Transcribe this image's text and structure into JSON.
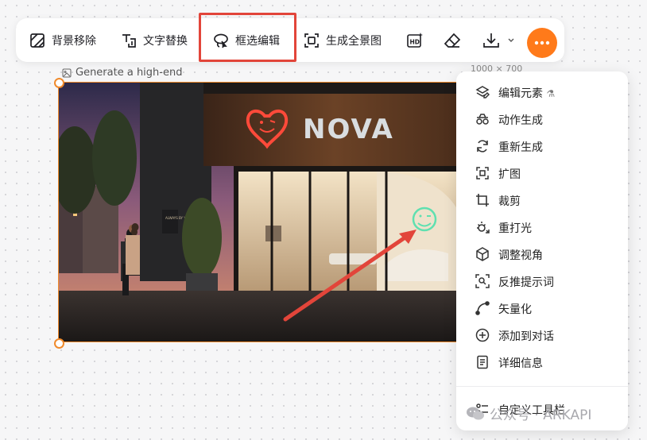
{
  "toolbar": {
    "items": [
      {
        "label": "背景移除",
        "icon": "background-remove-icon"
      },
      {
        "label": "文字替换",
        "icon": "text-replace-icon"
      },
      {
        "label": "框选编辑",
        "icon": "lasso-edit-icon"
      },
      {
        "label": "生成全景图",
        "icon": "panorama-icon"
      }
    ],
    "hd_icon": "hd-icon",
    "eraser_icon": "eraser-icon",
    "download_icon": "download-icon",
    "more_icon": "more-icon",
    "accent_color": "#ff7a1a",
    "highlight_color": "#e2453a"
  },
  "image": {
    "caption": "Generate a high-end",
    "dims": "1000 × 700",
    "sign_text": "NOVA",
    "wall_text": "ALWAYS BY YOUR SIDE",
    "selection_color": "#f08a2b"
  },
  "menu": {
    "items": [
      {
        "label": "编辑元素",
        "icon": "layers-edit-icon",
        "suffix": "⚗"
      },
      {
        "label": "动作生成",
        "icon": "action-generate-icon"
      },
      {
        "label": "重新生成",
        "icon": "regenerate-icon"
      },
      {
        "label": "扩图",
        "icon": "expand-icon"
      },
      {
        "label": "裁剪",
        "icon": "crop-icon"
      },
      {
        "label": "重打光",
        "icon": "relight-icon"
      },
      {
        "label": "调整视角",
        "icon": "cube-view-icon"
      },
      {
        "label": "反推提示词",
        "icon": "reverse-prompt-icon"
      },
      {
        "label": "矢量化",
        "icon": "vector-icon"
      },
      {
        "label": "添加到对话",
        "icon": "add-to-chat-icon"
      },
      {
        "label": "详细信息",
        "icon": "details-icon"
      }
    ],
    "footer_label": "自定义工具栏",
    "footer_icon": "customize-toolbar-icon"
  },
  "watermark": {
    "text": "公众号 · ARKAPI"
  }
}
